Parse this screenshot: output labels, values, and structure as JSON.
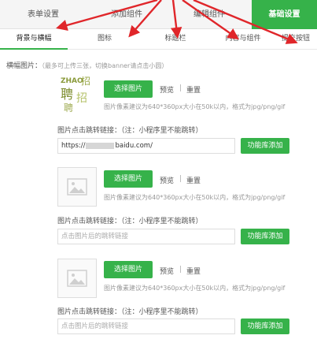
{
  "top_tabs": [
    "表单设置",
    "添加组件",
    "编辑组件",
    "基础设置"
  ],
  "sub_tabs": [
    "背景与横幅",
    "图标",
    "标题栏",
    "内容与组件",
    "提交按钮"
  ],
  "banner": {
    "title": "横幅图片：",
    "note": "（最多可上传三张，切换banner请点击小圆）"
  },
  "logo_text": [
    "ZHAO",
    "招",
    "聘",
    "招",
    "聘"
  ],
  "items": [
    {
      "choose_label": "选择图片",
      "preview_label": "预览",
      "separator": "|",
      "reset_label": "重置",
      "hint": "图片像素建议为640*360px大小在50k以内，格式为jpg/png/gif",
      "link_label": "图片点击跳转链接：（注：小程序里不能跳转）",
      "link_value": "https://",
      "link_value_tail": "baidu.com/",
      "link_placeholder": "",
      "add_label": "功能库添加"
    },
    {
      "choose_label": "选择图片",
      "preview_label": "预览",
      "separator": "|",
      "reset_label": "重置",
      "hint": "图片像素建议为640*360px大小在50k以内，格式为jpg/png/gif",
      "link_label": "图片点击跳转链接：（注：小程序里不能跳转）",
      "link_placeholder": "点击图片后的跳转链接",
      "add_label": "功能库添加"
    },
    {
      "choose_label": "选择图片",
      "preview_label": "预览",
      "separator": "|",
      "reset_label": "重置",
      "hint": "图片像素建议为640*360px大小在50k以内，格式为jpg/png/gif",
      "link_label": "图片点击跳转链接：（注：小程序里不能跳转）",
      "link_placeholder": "点击图片后的跳转链接",
      "add_label": "功能库添加"
    }
  ],
  "colors": {
    "accent": "#36b24a",
    "arrow": "#e0262a"
  }
}
